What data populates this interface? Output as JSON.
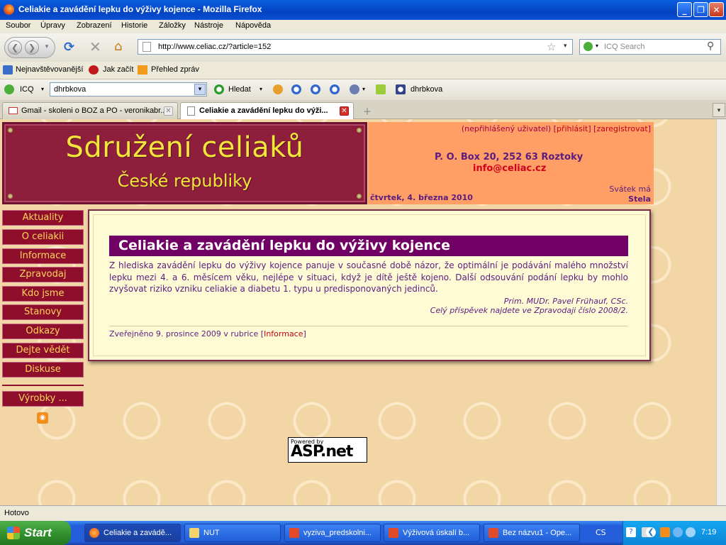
{
  "window": {
    "title": "Celiakie a zavádění lepku do výživy kojence - Mozilla Firefox"
  },
  "menu": [
    "Soubor",
    "Úpravy",
    "Zobrazení",
    "Historie",
    "Záložky",
    "Nástroje",
    "Nápověda"
  ],
  "nav": {
    "url": "http://www.celiac.cz/?article=152",
    "search_placeholder": "ICQ Search"
  },
  "bookmarks": [
    "Nejnavštěvovanější",
    "Jak začít",
    "Přehled zpráv"
  ],
  "icq_toolbar": {
    "icq_label": "ICQ",
    "search_value": "dhrbkova",
    "find_label": "Hledat",
    "highlight_label": "dhrbkova"
  },
  "tabs": [
    {
      "label": "Gmail - skoleni o BOZ a PO - veronikabr...",
      "active": false
    },
    {
      "label": "Celiakie a zavádění lepku do výži...",
      "active": true
    }
  ],
  "site": {
    "logo_line1": "Sdružení celiaků",
    "logo_line2": "České republiky",
    "user_status": "(nepřihlášený uživatel)",
    "login_link": "přihlásit",
    "register_link": "zaregistrovat",
    "address": "P. O. Box 20, 252 63 Roztoky",
    "email": "info@celiac.cz",
    "date": "čtvrtek, 4. března 2010",
    "nameday_label": "Svátek má",
    "nameday_name": "Stela"
  },
  "sidenav": [
    "Aktuality",
    "O celiakii",
    "Informace",
    "Zpravodaj",
    "Kdo jsme",
    "Stanovy",
    "Odkazy",
    "Dejte vědět",
    "Diskuse"
  ],
  "products_link": "Výrobky ...",
  "article": {
    "title": "Celiakie a zavádění lepku do výživy kojence",
    "body": "Z hlediska zavádění lepku do výživy kojence panuje v současné době názor, že optimální je podávání malého množství lepku mezi 4. a 6. měsícem věku, nejlépe v situaci, když je dítě ještě kojeno. Další odsouvání podání lepku by mohlo zvyšovat riziko vzniku celiakie a diabetu 1. typu u predisponovaných jedinců.",
    "author": "Prim. MUDr. Pavel Frühauf, CSc.",
    "source": "Celý příspěvek najdete ve Zpravodaji číslo 2008/2.",
    "published_prefix": "Zveřejněno 9. prosince 2009 v rubrice",
    "category": "Informace"
  },
  "aspnet": {
    "powered": "Powered by",
    "logo": "ASP.net"
  },
  "status": "Hotovo",
  "taskbar": {
    "start": "Start",
    "tasks": [
      "Celiakie a zavádě...",
      "NUT",
      "vyziva_predskolni...",
      "Výživová úskalí b...",
      "Bez názvu1 - Ope..."
    ],
    "lang": "CS",
    "clock": "7:19"
  },
  "colors": {
    "banner": "#8e1f3c",
    "logo_text": "#f2e63a",
    "infobox": "#ff9f65",
    "nav_item": "#8e0e2c",
    "title_bar": "#700063",
    "text": "#5a1c80",
    "link": "#c2001a"
  }
}
